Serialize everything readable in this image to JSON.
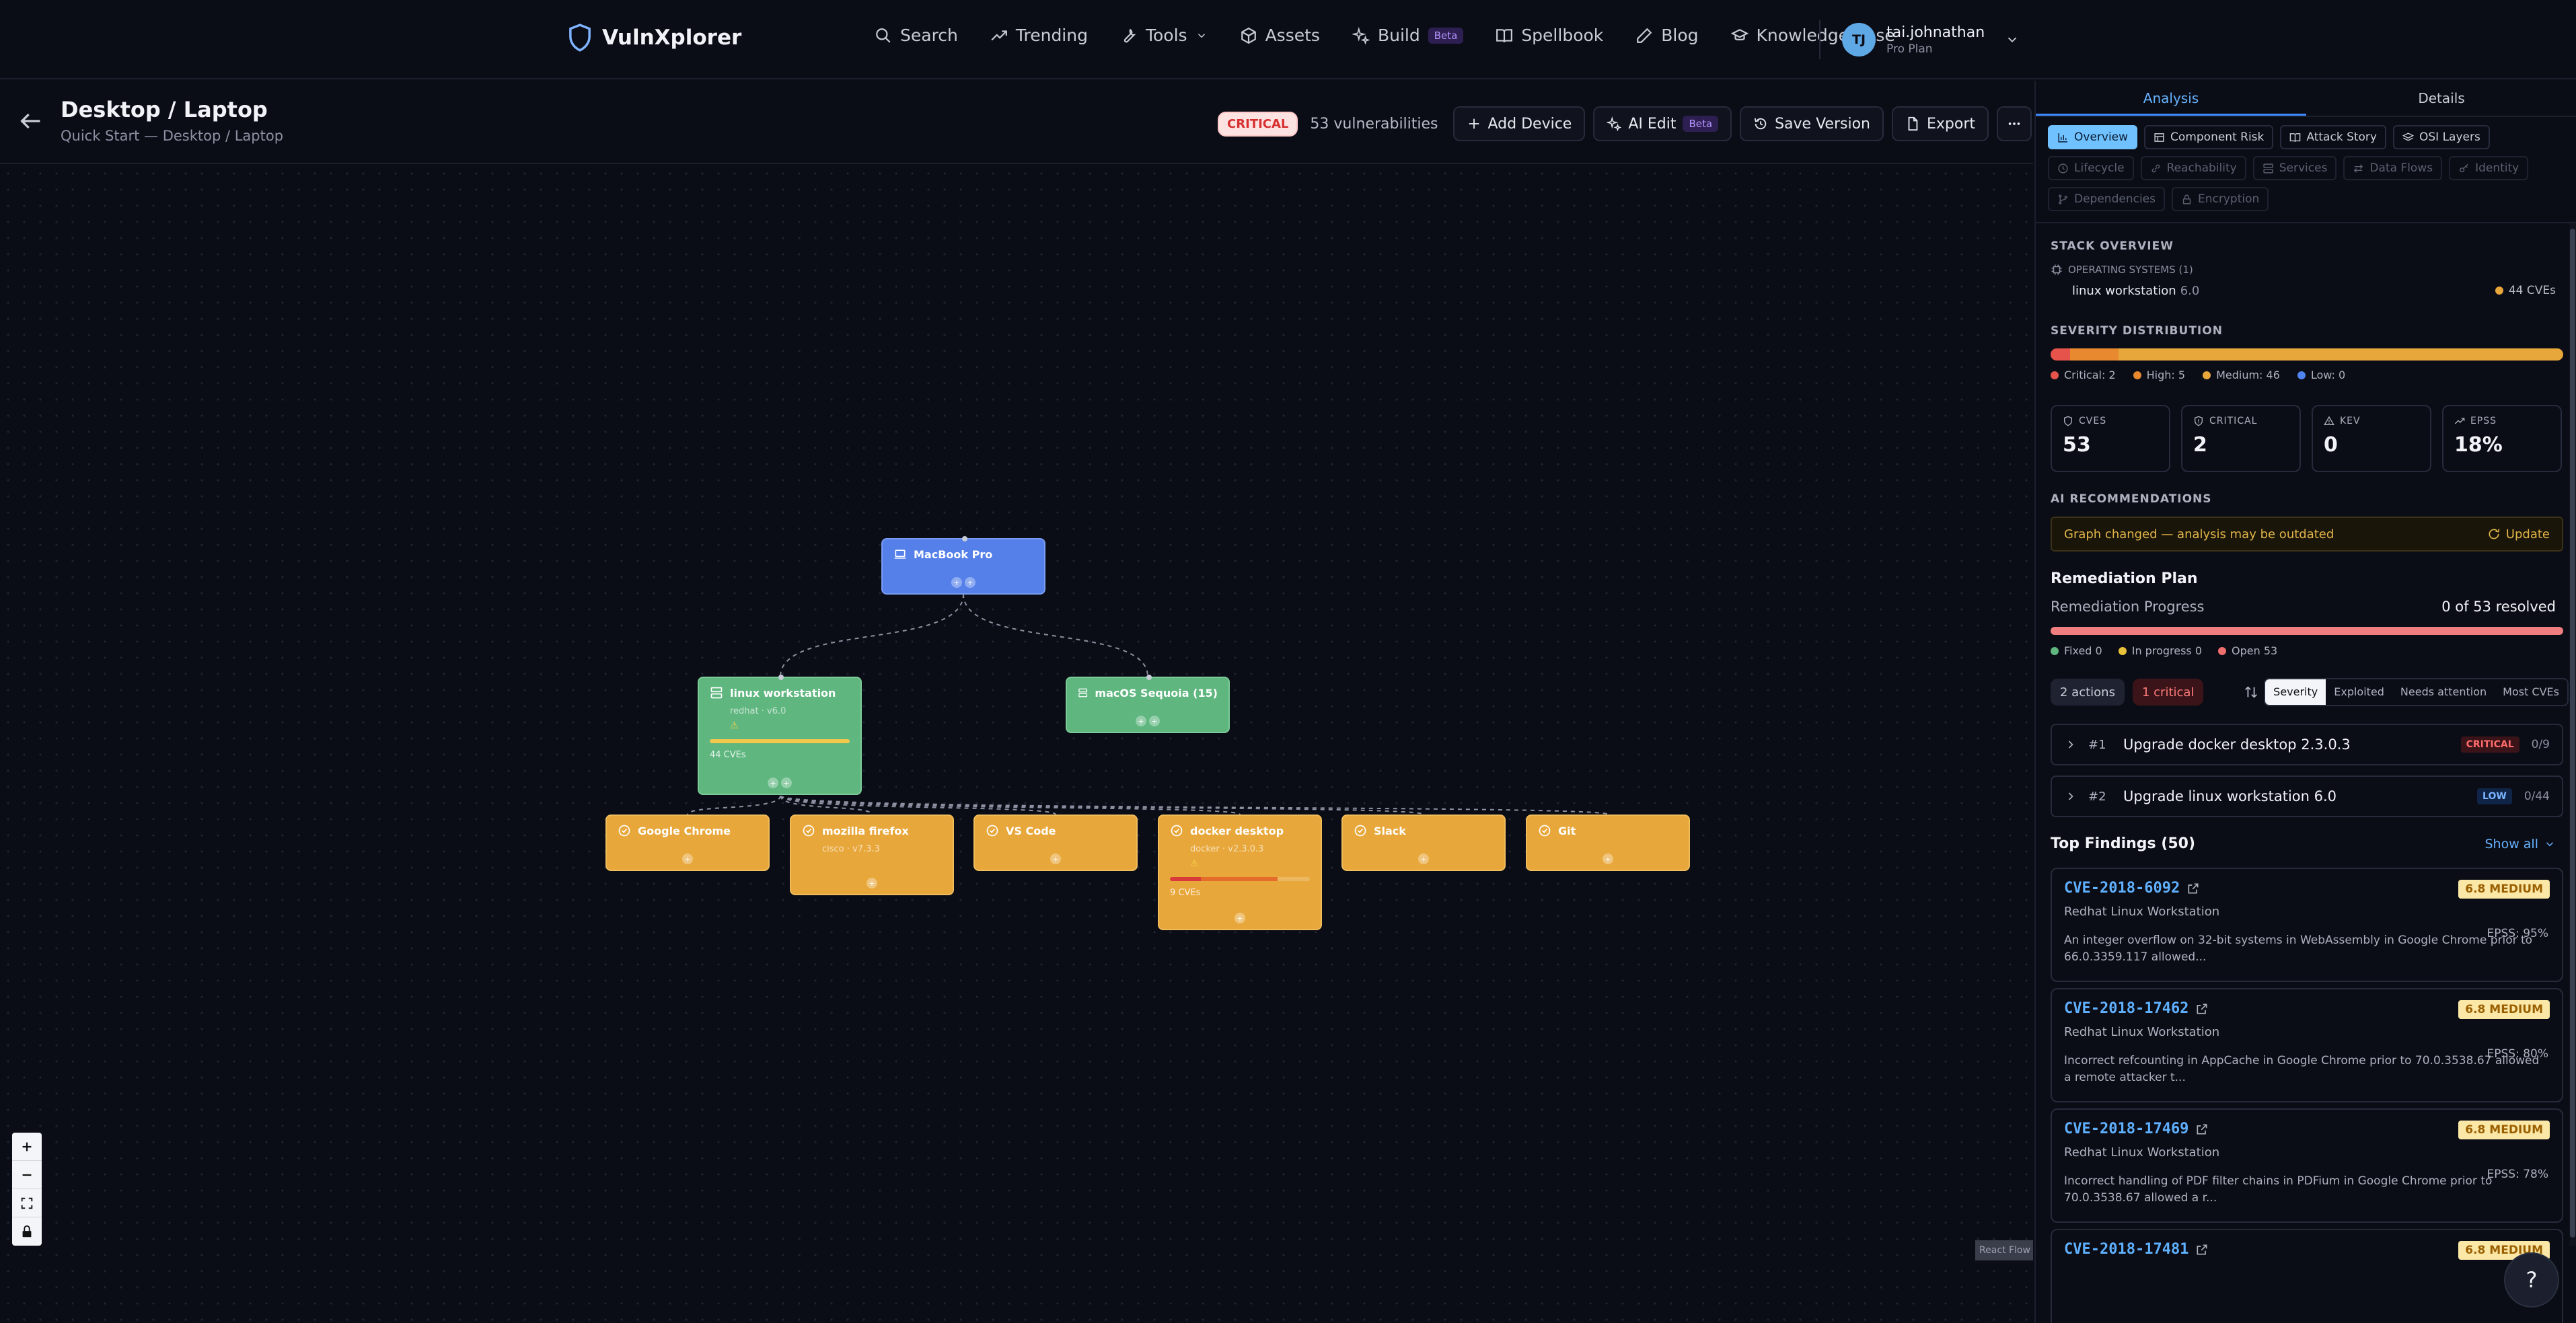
{
  "app": {
    "name": "VulnXplorer"
  },
  "nav": {
    "items": [
      {
        "label": "Search",
        "icon": "search-icon"
      },
      {
        "label": "Trending",
        "icon": "trending-icon"
      },
      {
        "label": "Tools",
        "icon": "wrench-icon"
      },
      {
        "label": "Assets",
        "icon": "box-icon"
      },
      {
        "label": "Build",
        "icon": "sparkle-icon",
        "badge": "Beta"
      },
      {
        "label": "Spellbook",
        "icon": "book-icon"
      },
      {
        "label": "Blog",
        "icon": "pen-icon"
      },
      {
        "label": "Knowledge Base",
        "icon": "graduation-cap-icon"
      }
    ]
  },
  "user": {
    "initials": "TJ",
    "name": "tai.johnathan",
    "plan": "Pro Plan"
  },
  "header": {
    "title": "Desktop / Laptop",
    "breadcrumb": "Quick Start — Desktop / Laptop",
    "risk_badge": "CRITICAL",
    "vuln_count": "53 vulnerabilities",
    "add_device": "Add Device",
    "ai_edit": "AI Edit",
    "ai_edit_badge": "Beta",
    "save_version": "Save Version",
    "export": "Export"
  },
  "graph": {
    "nodes": {
      "macbook": {
        "title": "MacBook Pro",
        "icon": "laptop-icon"
      },
      "linux": {
        "title": "linux workstation",
        "sub": "redhat · v6.0",
        "warn": "⚠",
        "cves": "44 CVEs",
        "icon": "server-icon"
      },
      "macos": {
        "title": "macOS Sequoia (15)",
        "icon": "server-icon"
      },
      "chrome": {
        "title": "Google Chrome",
        "icon": "package-icon"
      },
      "firefox": {
        "title": "mozilla firefox",
        "sub": "cisco · v7.3.3",
        "icon": "package-icon"
      },
      "vscode": {
        "title": "VS Code",
        "icon": "package-icon"
      },
      "docker": {
        "title": "docker desktop",
        "sub": "docker · v2.3.0.3",
        "warn": "⚠",
        "cves": "9 CVEs",
        "icon": "package-icon"
      },
      "slack": {
        "title": "Slack",
        "icon": "package-icon"
      },
      "git": {
        "title": "Git",
        "icon": "package-icon"
      }
    },
    "node_colors": {
      "device": "#5580ea",
      "os": "#5fb67f",
      "app": "#e8a73a"
    }
  },
  "panel": {
    "tabs": [
      "Analysis",
      "Details"
    ],
    "subtabs": [
      {
        "label": "Overview",
        "icon": "chart-icon",
        "state": "active"
      },
      {
        "label": "Component Risk",
        "icon": "table-icon",
        "state": "normal"
      },
      {
        "label": "Attack Story",
        "icon": "book-open-icon",
        "state": "normal"
      },
      {
        "label": "OSI Layers",
        "icon": "layers-icon",
        "state": "normal"
      },
      {
        "label": "Lifecycle",
        "icon": "clock-icon",
        "state": "disabled"
      },
      {
        "label": "Reachability",
        "icon": "link-icon",
        "state": "disabled"
      },
      {
        "label": "Services",
        "icon": "server-icon",
        "state": "disabled"
      },
      {
        "label": "Data Flows",
        "icon": "arrows-icon",
        "state": "disabled"
      },
      {
        "label": "Identity",
        "icon": "key-icon",
        "state": "disabled"
      },
      {
        "label": "Dependencies",
        "icon": "git-branch-icon",
        "state": "disabled"
      },
      {
        "label": "Encryption",
        "icon": "lock-icon",
        "state": "disabled"
      }
    ],
    "stack_overview": {
      "title": "STACK OVERVIEW",
      "os_heading": "OPERATING SYSTEMS (1)",
      "os_name": "linux workstation",
      "os_version": "6.0",
      "os_cves": "44 CVEs"
    },
    "severity": {
      "title": "SEVERITY DISTRIBUTION",
      "critical": 2,
      "high": 5,
      "medium": 46,
      "low": 0,
      "legend": [
        "Critical: 2",
        "High: 5",
        "Medium: 46",
        "Low: 0"
      ],
      "colors": {
        "critical": "#e5534b",
        "high": "#e8882f",
        "medium": "#e8a73a",
        "low": "#4f83f0"
      }
    },
    "stats": [
      {
        "label": "CVES",
        "value": "53",
        "icon": "shield-icon"
      },
      {
        "label": "CRITICAL",
        "value": "2",
        "icon": "shield-alert-icon"
      },
      {
        "label": "KEV",
        "value": "0",
        "icon": "warning-icon"
      },
      {
        "label": "EPSS",
        "value": "18%",
        "icon": "trending-icon"
      }
    ],
    "ai": {
      "title": "AI RECOMMENDATIONS",
      "banner": "Graph changed — analysis may be outdated",
      "update": "Update"
    },
    "remediation": {
      "title": "Remediation Plan",
      "progress_label": "Remediation Progress",
      "progress_value": "0 of 53 resolved",
      "resolved_fraction": 0,
      "legend": [
        "Fixed 0",
        "In progress 0",
        "Open 53"
      ],
      "chips": [
        "2 actions",
        "1 critical"
      ],
      "sort_options": [
        "Severity",
        "Exploited",
        "Needs attention",
        "Most CVEs"
      ],
      "sort_active": "Severity",
      "actions": [
        {
          "num": "#1",
          "title": "Upgrade docker desktop 2.3.0.3",
          "severity": "CRITICAL",
          "count": "0/9"
        },
        {
          "num": "#2",
          "title": "Upgrade linux workstation 6.0",
          "severity": "LOW",
          "count": "0/44"
        }
      ]
    },
    "findings": {
      "title": "Top Findings (50)",
      "show_all": "Show all",
      "items": [
        {
          "id": "CVE-2018-6092",
          "severity": "6.8 MEDIUM",
          "product": "Redhat Linux Workstation",
          "epss": "EPSS: 95%",
          "desc": "An integer overflow on 32-bit systems in WebAssembly in Google Chrome prior to 66.0.3359.117 allowed..."
        },
        {
          "id": "CVE-2018-17462",
          "severity": "6.8 MEDIUM",
          "product": "Redhat Linux Workstation",
          "epss": "EPSS: 80%",
          "desc": "Incorrect refcounting in AppCache in Google Chrome prior to 70.0.3538.67 allowed a remote attacker t..."
        },
        {
          "id": "CVE-2018-17469",
          "severity": "6.8 MEDIUM",
          "product": "Redhat Linux Workstation",
          "epss": "EPSS: 78%",
          "desc": "Incorrect handling of PDF filter chains in PDFium in Google Chrome prior to 70.0.3538.67 allowed a r..."
        },
        {
          "id": "CVE-2018-17481",
          "severity": "6.8 MEDIUM",
          "product": "",
          "epss": "",
          "desc": ""
        }
      ]
    }
  },
  "canvas": {
    "attribution": "React Flow",
    "help": "?"
  }
}
